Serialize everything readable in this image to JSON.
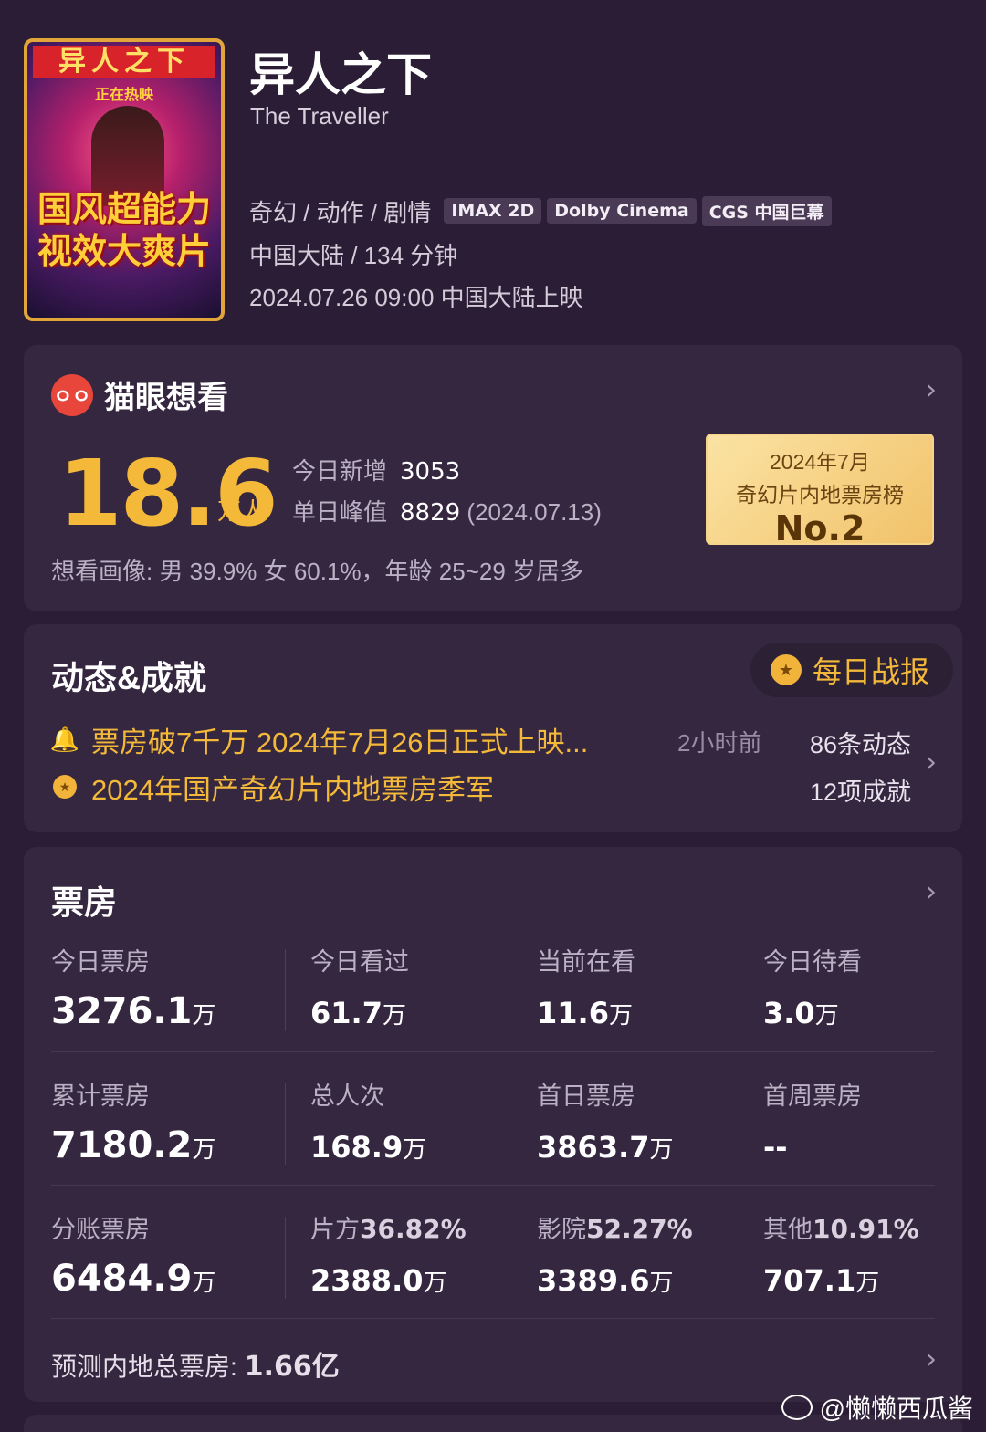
{
  "movie": {
    "poster": {
      "title": "异人之下",
      "subtitle": "正在热映",
      "slogan_line1": "国风超能力",
      "slogan_line2": "视效大爽片"
    },
    "title": "异人之下",
    "title_en": "The Traveller",
    "genre": "奇幻 / 动作 / 剧情",
    "tags": [
      "IMAX 2D",
      "Dolby Cinema",
      "CGS 中国巨幕"
    ],
    "region_duration": "中国大陆 / 134 分钟",
    "release": "2024.07.26 09:00 中国大陆上映"
  },
  "want": {
    "title": "猫眼想看",
    "logo_text": "ㅇㅇ",
    "count": "18.6",
    "unit": "万人",
    "today_label": "今日新增",
    "today_value": "3053",
    "peak_label": "单日峰值",
    "peak_value": "8829",
    "peak_date": "(2024.07.13)",
    "rank_line1": "2024年7月",
    "rank_line2": "奇幻片内地票房榜",
    "rank_value": "No.2",
    "portrait": "想看画像: 男 39.9%  女 60.1%，年龄 25~29 岁居多",
    "chevron": "›"
  },
  "dynamics": {
    "title": "动态&成就",
    "daily_report": "每日战报",
    "medal_icon": "★",
    "items": [
      {
        "icon": "🔔",
        "text": "票房破7千万 2024年7月26日正式上映...",
        "time": "2小时前",
        "count": "86条动态"
      },
      {
        "icon": "★",
        "text": "2024年国产奇幻片内地票房季军",
        "time": "",
        "count": "12项成就"
      }
    ],
    "chevron": "›"
  },
  "boxoffice": {
    "title": "票房",
    "chevron": "›",
    "rows": [
      [
        {
          "label": "今日票房",
          "value": "3276.1",
          "unit": "万"
        },
        {
          "label": "今日看过",
          "value": "61.7",
          "unit": "万"
        },
        {
          "label": "当前在看",
          "value": "11.6",
          "unit": "万"
        },
        {
          "label": "今日待看",
          "value": "3.0",
          "unit": "万"
        }
      ],
      [
        {
          "label": "累计票房",
          "value": "7180.2",
          "unit": "万"
        },
        {
          "label": "总人次",
          "value": "168.9",
          "unit": "万"
        },
        {
          "label": "首日票房",
          "value": "3863.7",
          "unit": "万"
        },
        {
          "label": "首周票房",
          "value": "--",
          "unit": ""
        }
      ],
      [
        {
          "label": "分账票房",
          "value": "6484.9",
          "unit": "万"
        },
        {
          "label": "片方",
          "label_pct": "36.82%",
          "value": "2388.0",
          "unit": "万"
        },
        {
          "label": "影院",
          "label_pct": "52.27%",
          "value": "3389.6",
          "unit": "万"
        },
        {
          "label": "其他",
          "label_pct": "10.91%",
          "value": "707.1",
          "unit": "万"
        }
      ]
    ],
    "forecast_label": "预测内地总票房:",
    "forecast_value": "1.66亿"
  },
  "watermark": "@懒懒西瓜酱",
  "colors": {
    "background": "#2a1d35",
    "card": "#35273f",
    "accent": "#f5b93a"
  }
}
